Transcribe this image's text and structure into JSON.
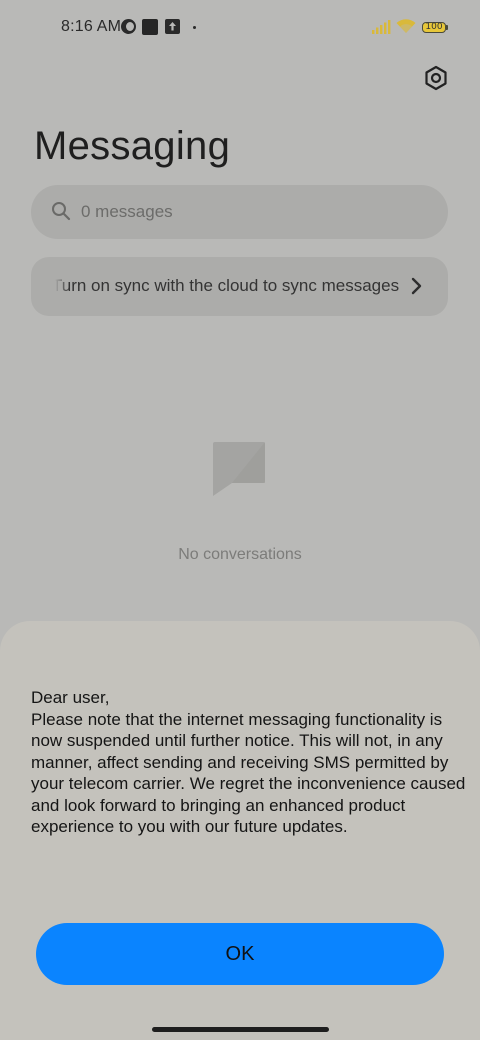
{
  "status_bar": {
    "time": "8:16 AM",
    "battery": "100",
    "icons": [
      "moon-icon",
      "square-notification-icon",
      "upload-icon",
      "notification-dot-icon",
      "signal-icon",
      "wifi-icon",
      "battery-icon"
    ]
  },
  "header": {
    "title": "Messaging",
    "settings_icon": "settings-icon"
  },
  "search": {
    "placeholder": "0 messages",
    "icon": "search-icon"
  },
  "sync_banner": {
    "text": "Turn on sync with the cloud to sync messages",
    "icon": "chevron-right-icon"
  },
  "empty_state": {
    "icon": "empty-message-icon",
    "label": "No conversations"
  },
  "dialog": {
    "message": "Dear user,\nPlease note that the internet messaging functionality is now suspended until further notice. This will not, in any manner, affect sending and receiving SMS permitted by your telecom carrier. We regret the inconvenience caused and look forward to bringing an enhanced product experience to you with our future updates.",
    "ok_label": "OK"
  },
  "colors": {
    "accent": "#0a84ff",
    "scrim_background": "#b9b9b7",
    "dialog_background": "#c4c2bc"
  }
}
